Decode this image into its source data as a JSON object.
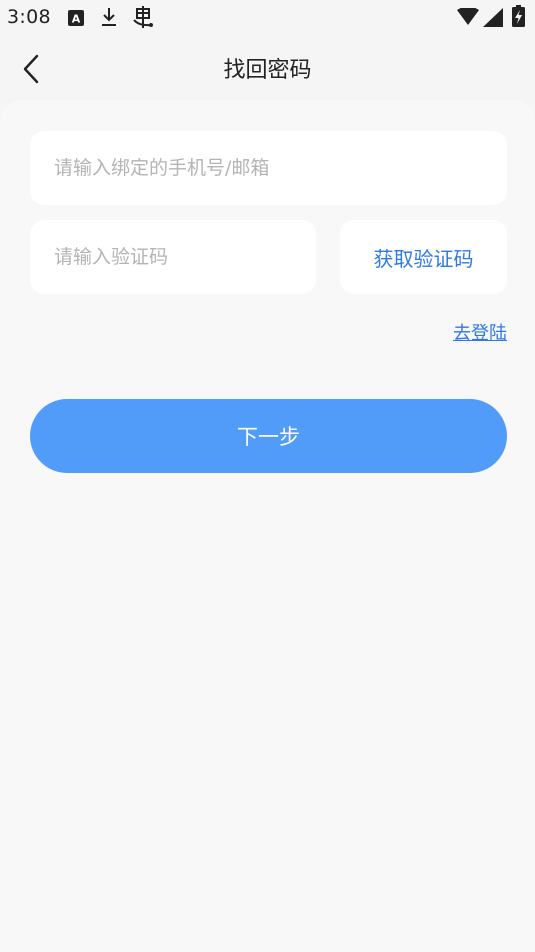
{
  "status_bar": {
    "time": "3:08",
    "icons": [
      "a-notification-icon",
      "download-icon",
      "bug-icon",
      "wifi-icon",
      "signal-icon",
      "battery-charging-icon"
    ]
  },
  "header": {
    "title": "找回密码",
    "back_icon": "chevron-left-icon"
  },
  "form": {
    "account_placeholder": "请输入绑定的手机号/邮箱",
    "account_value": "",
    "code_placeholder": "请输入验证码",
    "code_value": "",
    "get_code_label": "获取验证码",
    "login_link": "去登陆",
    "next_label": "下一步"
  },
  "colors": {
    "accent": "#2f79e5",
    "primary_button": "#519cf8",
    "background": "#f5f5f5",
    "input_bg": "#ffffff",
    "placeholder": "#b4b4b4"
  }
}
